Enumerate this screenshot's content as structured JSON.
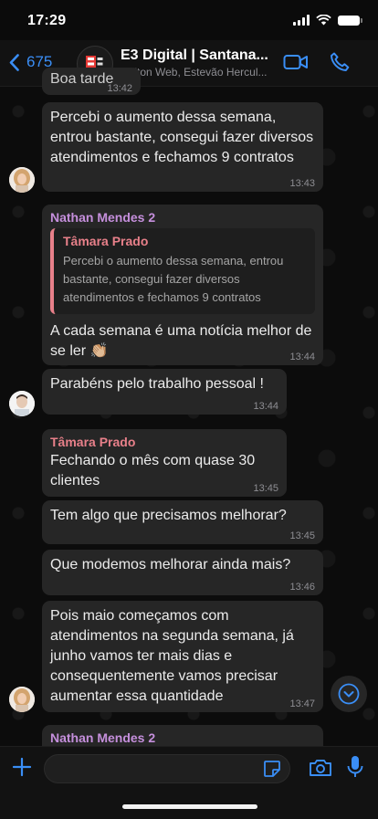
{
  "status_bar": {
    "time": "17:29"
  },
  "header": {
    "back_count": "675",
    "title": "E3 Digital | Santana...",
    "subtitle": "Dalton Web, Estevão Hercul..."
  },
  "colors": {
    "accent": "#3a8ef6",
    "nathan": "#c58fdc",
    "tamara": "#e8808a",
    "bubble": "#262626"
  },
  "messages": [
    {
      "text": "Boa tarde",
      "time": "13:42"
    },
    {
      "text": "Percebi o aumento dessa semana, entrou bastante, consegui fazer diversos atendimentos e fechamos 9 contratos",
      "time": "13:43"
    },
    {
      "sender": "Nathan Mendes 2",
      "quote": {
        "name": "Tâmara Prado",
        "text": "Percebi o aumento dessa semana, entrou bastante, consegui fazer diversos atendimentos e fechamos 9 contratos"
      },
      "text": "A cada semana é uma notícia melhor de se ler 👏🏼",
      "time": "13:44"
    },
    {
      "text": "Parabéns pelo trabalho pessoal !",
      "time": "13:44"
    },
    {
      "sender": "Tâmara Prado",
      "text": "Fechando o mês com quase 30 clientes",
      "time": "13:45"
    },
    {
      "text": "Tem algo que precisamos melhorar?",
      "time": "13:45"
    },
    {
      "text": "Que modemos melhorar ainda mais?",
      "time": "13:46"
    },
    {
      "text": "Pois maio começamos com atendimentos na segunda semana, já junho vamos ter mais dias e consequentemente vamos precisar aumentar essa quantidade",
      "time": "13:47"
    },
    {
      "sender": "Nathan Mendes 2"
    }
  ],
  "icons": {
    "back": "chevron-left-icon",
    "video": "video-camera-icon",
    "call": "phone-icon",
    "plus": "plus-icon",
    "sticker": "sticker-icon",
    "camera": "camera-icon",
    "mic": "microphone-icon",
    "scroll": "chevron-down-circle-icon"
  }
}
